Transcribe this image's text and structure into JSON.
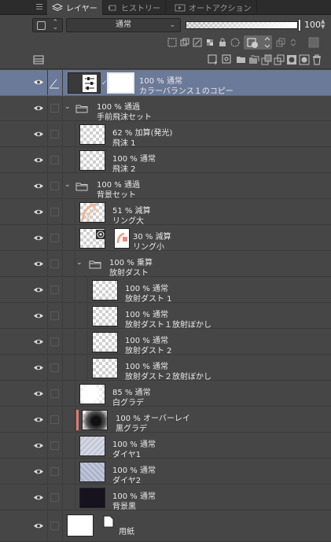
{
  "tabs": [
    {
      "label": "レイヤー",
      "active": true
    },
    {
      "label": "ヒストリー",
      "active": false
    },
    {
      "label": "オートアクション",
      "active": false
    }
  ],
  "blend_mode": "通常",
  "opacity_value": "100",
  "opacity_level": 1.0,
  "accent_color": "#6c7a99",
  "clip_marker_color": "#e07a6f",
  "layers": [
    {
      "line1": "100 % 通常",
      "line2": "カラーバランス１のコピー"
    },
    {
      "line1": "100 % 通過",
      "line2": "手前飛沫セット"
    },
    {
      "line1": "62 % 加算(発光)",
      "line2": "飛沫 1"
    },
    {
      "line1": "100 % 通常",
      "line2": "飛沫 2"
    },
    {
      "line1": "100 % 通過",
      "line2": "背景セット"
    },
    {
      "line1": "51 % 減算",
      "line2": "リング大"
    },
    {
      "line1": "30 % 減算",
      "line2": "リング小"
    },
    {
      "line1": "100 % 乗算",
      "line2": "放射ダスト"
    },
    {
      "line1": "100 % 通常",
      "line2": "放射ダスト 1"
    },
    {
      "line1": "100 % 通常",
      "line2": "放射ダスト１放射ぼかし"
    },
    {
      "line1": "100 % 通常",
      "line2": "放射ダスト 2"
    },
    {
      "line1": "100 % 通常",
      "line2": "放射ダスト２放射ぼかし"
    },
    {
      "line1": "85 % 通常",
      "line2": "白グラデ"
    },
    {
      "line1": "100 % オーバーレイ",
      "line2": "黒グラデ"
    },
    {
      "line1": "100 % 通常",
      "line2": "ダイヤ1"
    },
    {
      "line1": "100 % 通常",
      "line2": "ダイヤ2"
    },
    {
      "line1": "100 % 通常",
      "line2": "背景黒"
    },
    {
      "line1": "",
      "line2": "用紙"
    }
  ]
}
